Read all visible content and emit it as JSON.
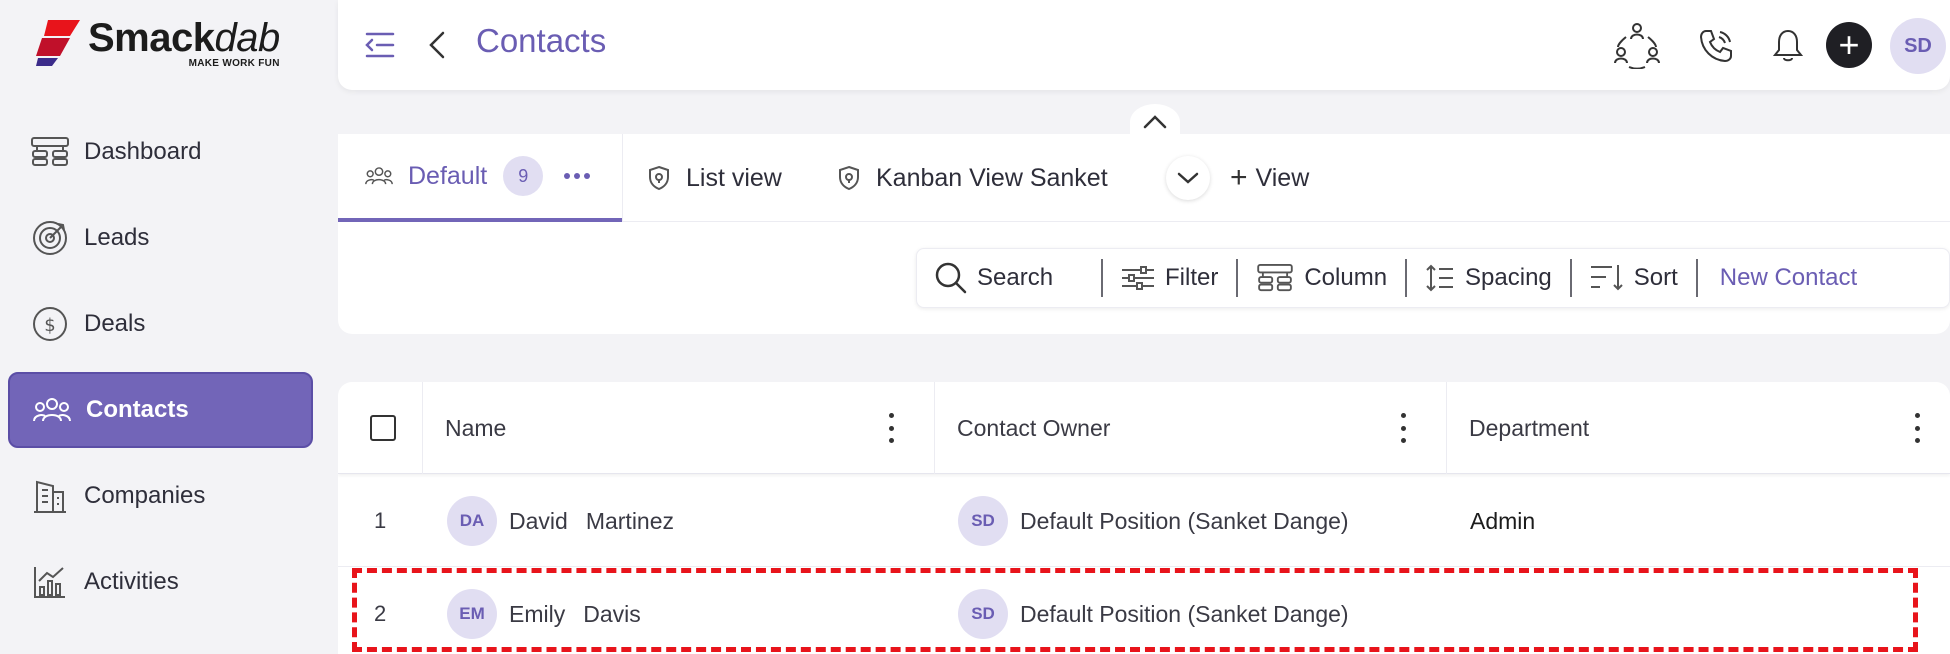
{
  "brand": {
    "name_bold": "Smack",
    "name_italic": "dab",
    "tagline": "MAKE WORK FUN",
    "accent": "#7265b8",
    "logo_red": "#e8141b"
  },
  "sidebar": {
    "items": [
      {
        "label": "Dashboard",
        "icon": "dashboard-icon"
      },
      {
        "label": "Leads",
        "icon": "target-icon"
      },
      {
        "label": "Deals",
        "icon": "dollar-icon"
      },
      {
        "label": "Contacts",
        "icon": "users-icon",
        "active": true
      },
      {
        "label": "Companies",
        "icon": "building-icon"
      },
      {
        "label": "Activities",
        "icon": "chart-icon"
      }
    ]
  },
  "header": {
    "title": "Contacts",
    "user_initials": "SD",
    "icons": [
      "menu-collapse-icon",
      "back-chevron-icon",
      "team-icon",
      "phone-icon",
      "bell-icon",
      "plus-icon"
    ]
  },
  "tabs": [
    {
      "label": "Default",
      "count": "9",
      "active": true
    },
    {
      "label": "List view"
    },
    {
      "label": "Kanban View Sanket"
    },
    {
      "label": "View"
    }
  ],
  "toolbar": {
    "search": "Search",
    "filter": "Filter",
    "column": "Column",
    "spacing": "Spacing",
    "sort": "Sort",
    "new_contact": "New Contact"
  },
  "table": {
    "columns": [
      "Name",
      "Contact Owner",
      "Department"
    ],
    "rows": [
      {
        "index": "1",
        "initials": "DA",
        "first": "David",
        "last": "Martinez",
        "owner_initials": "SD",
        "owner": "Default Position (Sanket Dange)",
        "department": "Admin"
      },
      {
        "index": "2",
        "initials": "EM",
        "first": "Emily",
        "last": "Davis",
        "owner_initials": "SD",
        "owner": "Default Position (Sanket Dange)",
        "department": ""
      }
    ]
  }
}
